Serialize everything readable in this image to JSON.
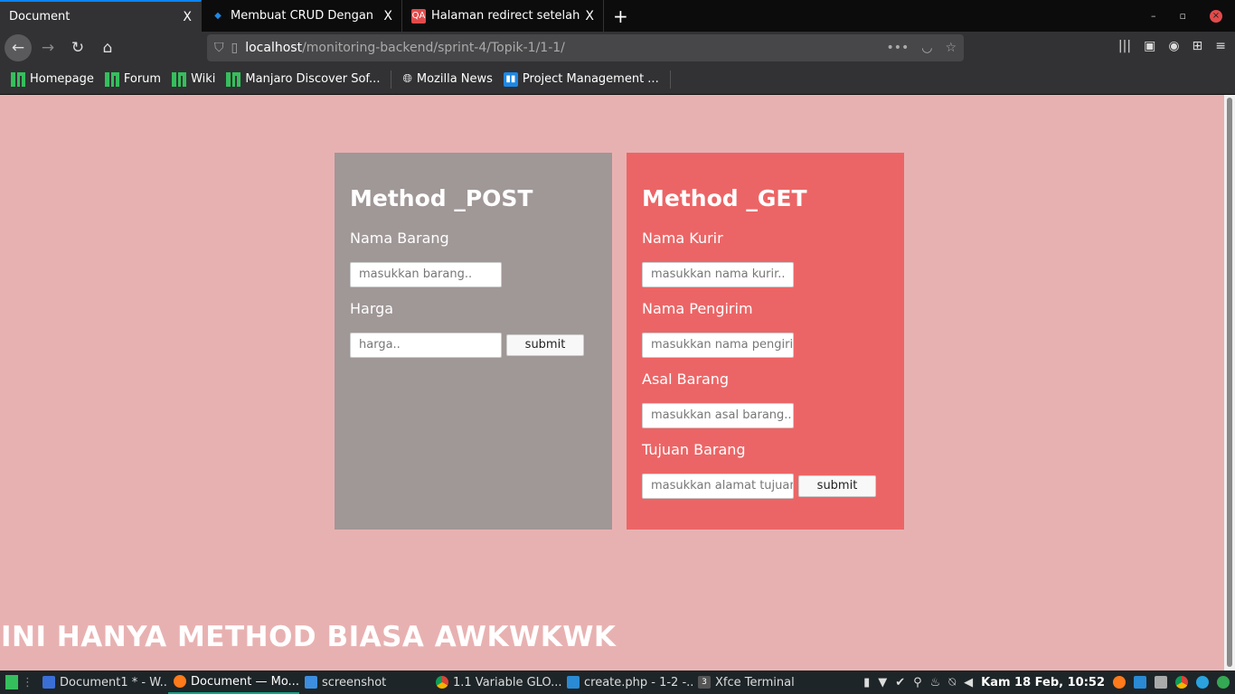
{
  "browser": {
    "tabs": [
      {
        "label": "Document",
        "active": true
      },
      {
        "label": "Membuat CRUD Dengan P",
        "active": false
      },
      {
        "label": "Halaman redirect setelah ",
        "active": false
      }
    ],
    "tab_close": "X",
    "new_tab": "+",
    "qa_badge": "QA",
    "url_host": "localhost",
    "url_path": "/monitoring-backend/sprint-4/Topik-1/1-1/",
    "bookmarks": [
      "Homepage",
      "Forum",
      "Wiki",
      "Manjaro Discover Sof...",
      "Mozilla News",
      "Project Management ..."
    ]
  },
  "post_form": {
    "title": "Method _POST",
    "fields": [
      {
        "label": "Nama Barang",
        "placeholder": "masukkan barang.."
      },
      {
        "label": "Harga",
        "placeholder": "harga.."
      }
    ],
    "submit": "submit"
  },
  "get_form": {
    "title": "Method _GET",
    "fields": [
      {
        "label": "Nama Kurir",
        "placeholder": "masukkan nama kurir.."
      },
      {
        "label": "Nama Pengirim",
        "placeholder": "masukkan nama pengirim"
      },
      {
        "label": "Asal Barang",
        "placeholder": "masukkan asal barang.."
      },
      {
        "label": "Tujuan Barang",
        "placeholder": "masukkan alamat tujuan"
      }
    ],
    "submit": "submit"
  },
  "footer_text": "INI HANYA METHOD BIASA AWKWKWK",
  "taskbar": {
    "tasks": [
      "Document1 * - W...",
      "Document — Mo...",
      "screenshot",
      "1.1 Variable GLO...",
      "create.php - 1-2 -...",
      "Xfce Terminal"
    ],
    "terminal_badge": "3",
    "clock": "Kam 18 Feb, 10:52"
  },
  "colors": {
    "page_bg": "#e8b1b1",
    "post_bg": "#a09797",
    "get_bg": "#ec6566"
  }
}
